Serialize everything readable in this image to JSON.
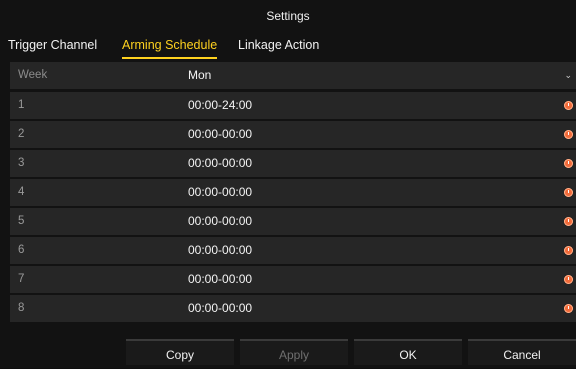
{
  "window": {
    "title": "Settings"
  },
  "tabs": [
    {
      "label": "Trigger Channel",
      "active": false
    },
    {
      "label": "Arming Schedule",
      "active": true
    },
    {
      "label": "Linkage Action",
      "active": false
    }
  ],
  "schedule": {
    "header": {
      "label": "Week",
      "value": "Mon"
    },
    "rows": [
      {
        "index": "1",
        "time": "00:00-24:00"
      },
      {
        "index": "2",
        "time": "00:00-00:00"
      },
      {
        "index": "3",
        "time": "00:00-00:00"
      },
      {
        "index": "4",
        "time": "00:00-00:00"
      },
      {
        "index": "5",
        "time": "00:00-00:00"
      },
      {
        "index": "6",
        "time": "00:00-00:00"
      },
      {
        "index": "7",
        "time": "00:00-00:00"
      },
      {
        "index": "8",
        "time": "00:00-00:00"
      }
    ],
    "icon": "clock-icon",
    "icon_color": "#f26b3a"
  },
  "buttons": {
    "copy": "Copy",
    "apply": "Apply",
    "ok": "OK",
    "cancel": "Cancel"
  },
  "colors": {
    "accent": "#ffd21f",
    "background": "#121212",
    "row": "#262626"
  }
}
